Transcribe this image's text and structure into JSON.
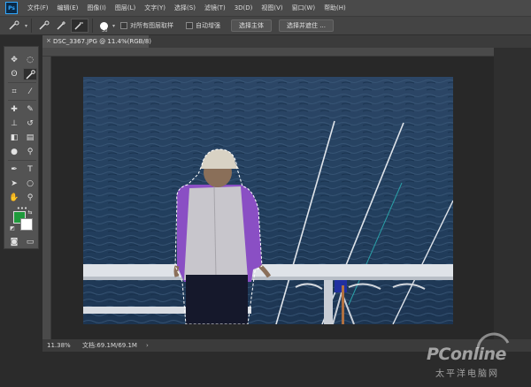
{
  "app": {
    "logo_text": "Ps",
    "menu": [
      "文件(F)",
      "编辑(E)",
      "图像(I)",
      "图层(L)",
      "文字(Y)",
      "选择(S)",
      "滤镜(T)",
      "3D(D)",
      "视图(V)",
      "窗口(W)",
      "帮助(H)"
    ]
  },
  "options_bar": {
    "brush_size": "30",
    "sample_all_layers_label": "对所有图层取样",
    "auto_enhance_label": "自动增强",
    "select_subject_label": "选择主体",
    "select_and_mask_label": "选择并遮住 ..."
  },
  "document": {
    "tab_title": "DSC_3367.JPG @ 11.4%(RGB/8)",
    "close_glyph": "×"
  },
  "toolbar": {
    "more_tools": "•••",
    "type_tool_glyph": "T"
  },
  "status_bar": {
    "zoom": "11.38%",
    "doc_info": "文档:69.1M/69.1M",
    "arrow": "›"
  },
  "watermark": {
    "brand": "PConline",
    "sub": "太平洋电脑网"
  },
  "colors": {
    "foreground": "#1f9a3c",
    "background": "#ffffff",
    "menubar": "#4a4a4a",
    "panel": "#535353",
    "canvas_bg": "#282828"
  },
  "icons": {
    "logo": "photoshop-logo-icon",
    "quick_select": "quick-selection-icon",
    "brush": "brush-icon",
    "checkbox": "checkbox-icon"
  }
}
